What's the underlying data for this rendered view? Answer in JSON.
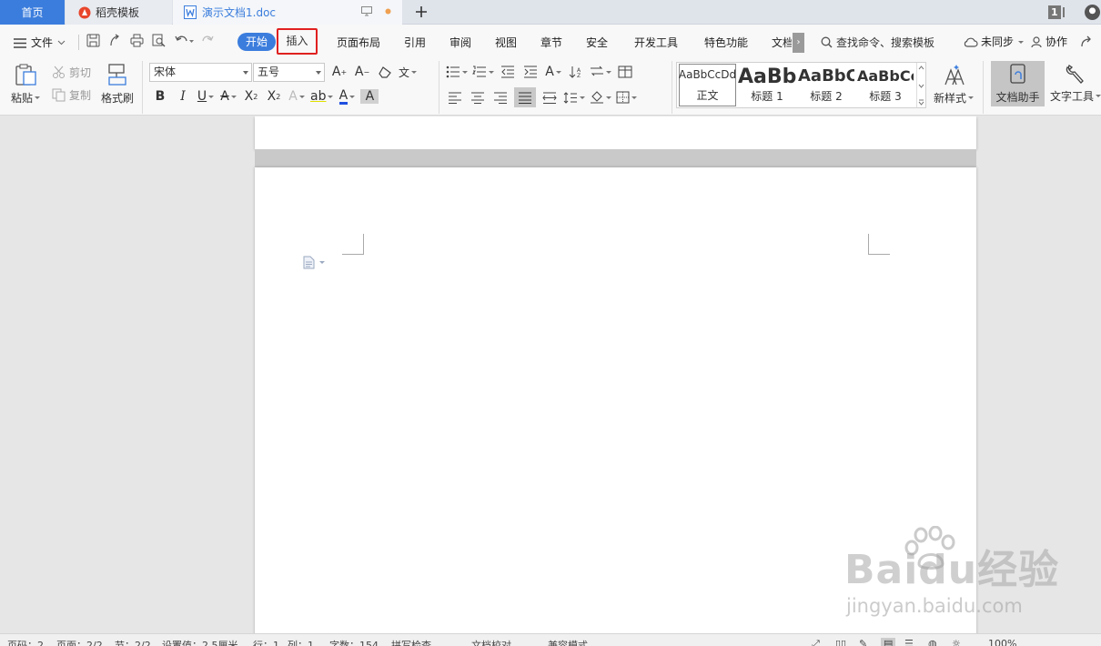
{
  "titlebar": {
    "home_tab": "首页",
    "template_tab": "稻壳模板",
    "doc_tab": "演示文档1.doc",
    "window_badge": "1"
  },
  "menu": {
    "file": "文件",
    "tabs": [
      "开始",
      "插入",
      "页面布局",
      "引用",
      "审阅",
      "视图",
      "章节",
      "安全",
      "开发工具",
      "特色功能",
      "文档"
    ],
    "search": "查找命令、搜索模板",
    "sync": "未同步",
    "collab": "协作"
  },
  "ribbon": {
    "paste": "粘贴",
    "cut": "剪切",
    "copy": "复制",
    "format_painter": "格式刷",
    "font_name": "宋体",
    "font_size": "五号",
    "styles": [
      {
        "preview": "AaBbCcDd",
        "name": "正文"
      },
      {
        "preview": "AaBb",
        "name": "标题 1"
      },
      {
        "preview": "AaBbC",
        "name": "标题 2"
      },
      {
        "preview": "AaBbCc",
        "name": "标题 3"
      }
    ],
    "new_style": "新样式",
    "doc_assistant": "文档助手",
    "text_tools": "文字工具"
  },
  "watermark": {
    "logo": "Baidu经验",
    "url": "jingyan.baidu.com"
  },
  "status": {
    "page": "页码：2",
    "pages": "页面：2/2",
    "section": "节：2/2",
    "position": "设置值：2.5厘米",
    "row": "行：1",
    "col": "列：1",
    "words": "字数：154",
    "spell": "拼写检查",
    "proof": "文档校对",
    "compat": "兼容模式",
    "zoom": "100%"
  },
  "colors": {
    "accent": "#3b7ddd",
    "highlight_box": "#e02020"
  }
}
